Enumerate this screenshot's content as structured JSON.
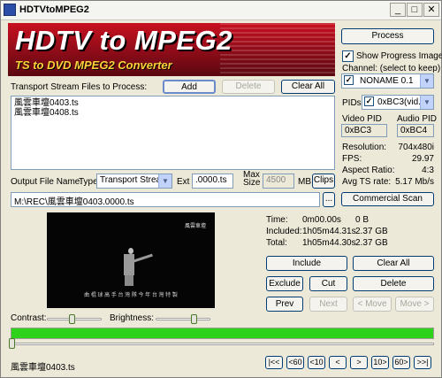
{
  "window": {
    "title": "HDTVtoMPEG2",
    "min_label": "_",
    "max_label": "□",
    "close_label": "✕"
  },
  "banner": {
    "title": "HDTV to MPEG2",
    "subtitle": "TS to DVD MPEG2 Converter"
  },
  "files": {
    "label": "Transport Stream Files to Process:",
    "add_label": "Add",
    "delete_label": "Delete",
    "clear_label": "Clear All",
    "items": [
      "風雲車壇0403.ts",
      "風雲車壇0408.ts"
    ]
  },
  "output": {
    "file_name_label": "Output File Name:",
    "type_label": "Type",
    "type_value": "Transport Stream",
    "ext_label": "Ext",
    "ext_value": ".0000.ts",
    "max_size_label": "Max\nSize",
    "max_size_value": "4500",
    "mb_label": "MB",
    "clips_label": "Clips",
    "path_value": "M:\\REC\\風雲車壇0403.0000.ts",
    "browse_label": "..."
  },
  "right": {
    "process_label": "Process",
    "show_progress_label": "Show Progress Image",
    "channel_label": "Channel:  (select to keep)",
    "channel_value": "NONAME 0.1",
    "pids_label": "PIDs:",
    "pids_value": "0xBC3(vid...",
    "video_pid_label": "Video PID",
    "audio_pid_label": "Audio PID",
    "video_pid_value": "0xBC3",
    "audio_pid_value": "0xBC4",
    "resolution_label": "Resolution:",
    "resolution_value": "704x480i",
    "fps_label": "FPS:",
    "fps_value": "29.97",
    "aspect_label": "Aspect Ratio:",
    "aspect_value": "4:3",
    "avg_label": "Avg TS rate:",
    "avg_value": "5.17 Mb/s",
    "commercial_label": "Commercial Scan"
  },
  "stats": {
    "time_label": "Time:",
    "time_value": "0m00.00s",
    "time_size": "0 B",
    "included_label": "Included:",
    "included_value": "1h05m44.31s",
    "included_size": "2.37 GB",
    "total_label": "Total:",
    "total_value": "1h05m44.30s",
    "total_size": "2.37 GB"
  },
  "edit": {
    "include_label": "Include",
    "clear_all_label": "Clear All",
    "exclude_label": "Exclude",
    "cut_label": "Cut",
    "delete_label": "Delete",
    "prev_label": "Prev",
    "next_label": "Next",
    "move_left_label": "< Move",
    "move_right_label": "Move >"
  },
  "video": {
    "caption": "曲 棍 球 高 手 台 灣 隊 今 年 台 灣 特 製",
    "logo": "風雲車壇"
  },
  "controls": {
    "contrast_label": "Contrast:",
    "brightness_label": "Brightness:",
    "contrast_level": 0.45,
    "brightness_level": 0.7,
    "progress_fraction": 1.0,
    "seek_fraction": 0.0
  },
  "nav": {
    "status_text": "風雲車壇0403.ts",
    "first_label": "|<<",
    "back60_label": "<60",
    "back10_label": "<10",
    "back1_label": "<",
    "fwd1_label": ">",
    "fwd10_label": "10>",
    "fwd60_label": "60>",
    "last_label": ">>|"
  },
  "colors": {
    "banner_red": "#c81020",
    "subtitle_yellow": "#ffd23a",
    "progress_green": "#2ed21a"
  }
}
